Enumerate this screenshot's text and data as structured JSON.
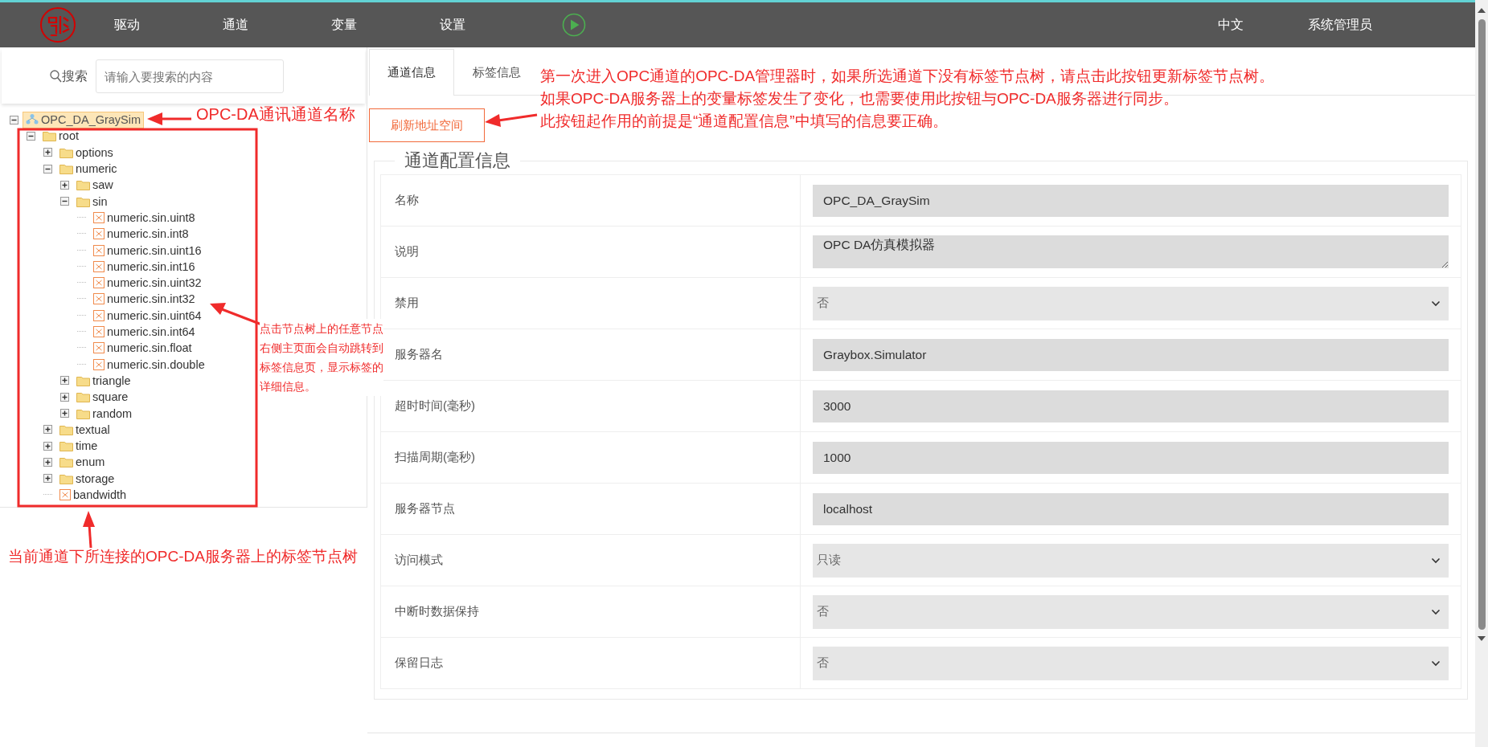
{
  "nav": {
    "items": [
      {
        "label": "驱动",
        "selected": false
      },
      {
        "label": "通道",
        "selected": false
      },
      {
        "label": "变量",
        "selected": false
      },
      {
        "label": "设置",
        "selected": false
      }
    ],
    "language": "中文",
    "user": "系统管理员"
  },
  "search": {
    "label": "搜索",
    "placeholder": "请输入要搜索的内容"
  },
  "tree": [
    {
      "label": "OPC_DA_GraySim",
      "kind": "channel",
      "expanded": true,
      "selected": true,
      "children": [
        {
          "label": "root",
          "kind": "folder",
          "expanded": true,
          "selected": false,
          "children": [
            {
              "label": "options",
              "kind": "folder",
              "expanded": false,
              "selected": false
            },
            {
              "label": "numeric",
              "kind": "folder",
              "expanded": true,
              "selected": false,
              "children": [
                {
                  "label": "saw",
                  "kind": "folder",
                  "expanded": false,
                  "selected": false
                },
                {
                  "label": "sin",
                  "kind": "folder",
                  "expanded": true,
                  "selected": false,
                  "children": [
                    {
                      "label": "numeric.sin.uint8",
                      "kind": "tag",
                      "selected": false
                    },
                    {
                      "label": "numeric.sin.int8",
                      "kind": "tag",
                      "selected": false
                    },
                    {
                      "label": "numeric.sin.uint16",
                      "kind": "tag",
                      "selected": false
                    },
                    {
                      "label": "numeric.sin.int16",
                      "kind": "tag",
                      "selected": false
                    },
                    {
                      "label": "numeric.sin.uint32",
                      "kind": "tag",
                      "selected": false
                    },
                    {
                      "label": "numeric.sin.int32",
                      "kind": "tag",
                      "selected": false
                    },
                    {
                      "label": "numeric.sin.uint64",
                      "kind": "tag",
                      "selected": false
                    },
                    {
                      "label": "numeric.sin.int64",
                      "kind": "tag",
                      "selected": false
                    },
                    {
                      "label": "numeric.sin.float",
                      "kind": "tag",
                      "selected": false
                    },
                    {
                      "label": "numeric.sin.double",
                      "kind": "tag",
                      "selected": false
                    }
                  ]
                },
                {
                  "label": "triangle",
                  "kind": "folder",
                  "expanded": false,
                  "selected": false
                },
                {
                  "label": "square",
                  "kind": "folder",
                  "expanded": false,
                  "selected": false
                },
                {
                  "label": "random",
                  "kind": "folder",
                  "expanded": false,
                  "selected": false
                }
              ]
            },
            {
              "label": "textual",
              "kind": "folder",
              "expanded": false,
              "selected": false
            },
            {
              "label": "time",
              "kind": "folder",
              "expanded": false,
              "selected": false
            },
            {
              "label": "enum",
              "kind": "folder",
              "expanded": false,
              "selected": false
            },
            {
              "label": "storage",
              "kind": "folder",
              "expanded": false,
              "selected": false
            },
            {
              "label": "bandwidth",
              "kind": "tag",
              "selected": false
            }
          ]
        }
      ]
    }
  ],
  "tabs": [
    {
      "label": "通道信息",
      "selected": true
    },
    {
      "label": "标签信息",
      "selected": false
    }
  ],
  "refresh_button": "刷新地址空间",
  "config": {
    "legend": "通道配置信息",
    "fields": [
      {
        "label": "名称",
        "kind": "text",
        "value": "OPC_DA_GraySim"
      },
      {
        "label": "说明",
        "kind": "textarea",
        "value": "OPC DA仿真模拟器"
      },
      {
        "label": "禁用",
        "kind": "select",
        "value": "否"
      },
      {
        "label": "服务器名",
        "kind": "text",
        "value": "Graybox.Simulator"
      },
      {
        "label": "超时时间(毫秒)",
        "kind": "text",
        "value": "3000"
      },
      {
        "label": "扫描周期(毫秒)",
        "kind": "text",
        "value": "1000"
      },
      {
        "label": "服务器节点",
        "kind": "text",
        "value": "localhost"
      },
      {
        "label": "访问模式",
        "kind": "select",
        "value": "只读"
      },
      {
        "label": "中断时数据保持",
        "kind": "select",
        "value": "否"
      },
      {
        "label": "保留日志",
        "kind": "select",
        "value": "否"
      }
    ]
  },
  "annotations": {
    "channel_name": "OPC-DA通讯通道名称",
    "refresh_button": [
      "第一次进入OPC通道的OPC-DA管理器时，如果所选通道下没有标签节点树，请点击此按钮更新标签节点树。",
      "如果OPC-DA服务器上的变量标签发生了变化，也需要使用此按钮与OPC-DA服务器进行同步。",
      "此按钮起作用的前提是“通道配置信息”中填写的信息要正确。"
    ],
    "tree_click": [
      "点击节点树上的任意节点",
      "右侧主页面会自动跳转到",
      "标签信息页，显示标签的",
      "详细信息。"
    ],
    "tree_summary": "当前通道下所连接的OPC-DA服务器上的标签节点树"
  }
}
